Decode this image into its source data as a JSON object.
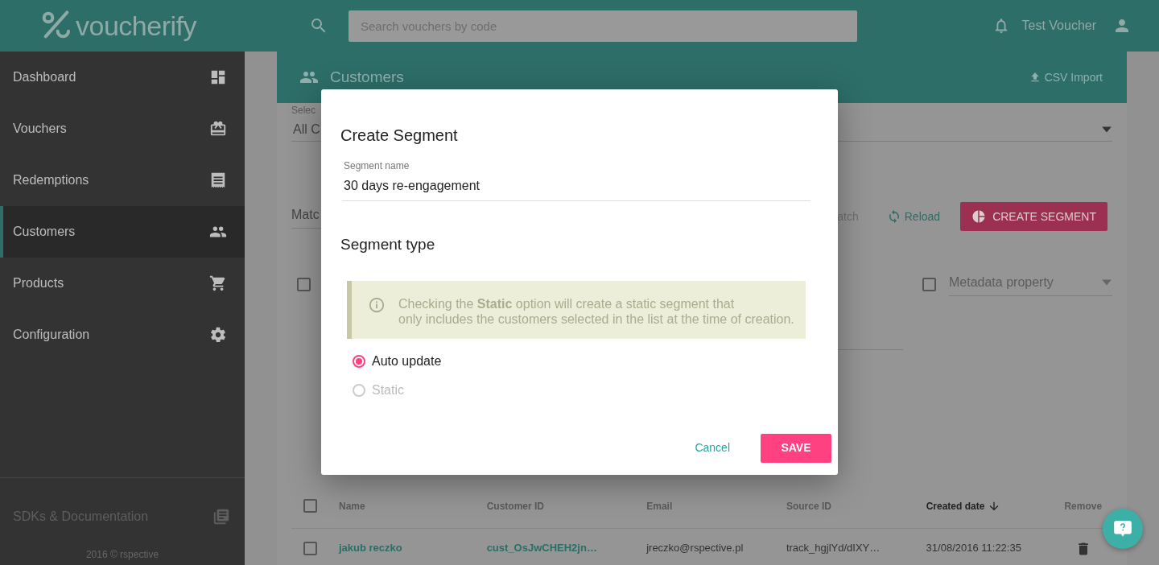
{
  "topbar": {
    "logo": "voucherify",
    "search": {
      "placeholder": "Search vouchers by code"
    },
    "user": "Test Voucher"
  },
  "sidebar": {
    "items": [
      {
        "label": "Dashboard",
        "selected": false
      },
      {
        "label": "Vouchers",
        "selected": false
      },
      {
        "label": "Redemptions",
        "selected": false
      },
      {
        "label": "Customers",
        "selected": true
      },
      {
        "label": "Products",
        "selected": false
      },
      {
        "label": "Configuration",
        "selected": false
      }
    ],
    "docs": "SDKs & Documentation",
    "footer": "2016 © rspective"
  },
  "page": {
    "title": "Customers",
    "import": "CSV Import",
    "select_label": "Selec",
    "select_value": "All C",
    "match_field": "Matc",
    "match_text": "atch",
    "reload": "Reload",
    "create_segment": "CREATE SEGMENT",
    "metadata_placeholder": "Metadata property",
    "filter_checks": [
      {
        "checked": false
      },
      {
        "checked": false
      }
    ]
  },
  "table": {
    "all_checked": false,
    "columns": [
      {
        "label": "Name",
        "sorted": false
      },
      {
        "label": "Customer ID",
        "sorted": false
      },
      {
        "label": "Email",
        "sorted": false
      },
      {
        "label": "Source ID",
        "sorted": false
      },
      {
        "label": "Created date",
        "sorted": true
      },
      {
        "label": "Remove",
        "sorted": false
      }
    ],
    "rows": [
      {
        "checked": false,
        "cells": [
          "jakub reczko",
          "cust_OsJwCHEH2jn…",
          "jreczko@rspective.pl",
          "track_hgjlYd/dIXY…",
          "31/08/2016 11:22:35"
        ]
      }
    ]
  },
  "dialog": {
    "title": "Create Segment",
    "name_label": "Segment name",
    "name_value": "30 days re-engagement",
    "type_title": "Segment type",
    "info": "Checking the **Static** option will create a static segment that\nonly includes the customers selected in the list at the time of creation.",
    "options": [
      {
        "label": "Auto update",
        "selected": true,
        "disabled": false
      },
      {
        "label": "Static",
        "selected": false,
        "disabled": true
      }
    ],
    "cancel": "Cancel",
    "save": "SAVE"
  }
}
